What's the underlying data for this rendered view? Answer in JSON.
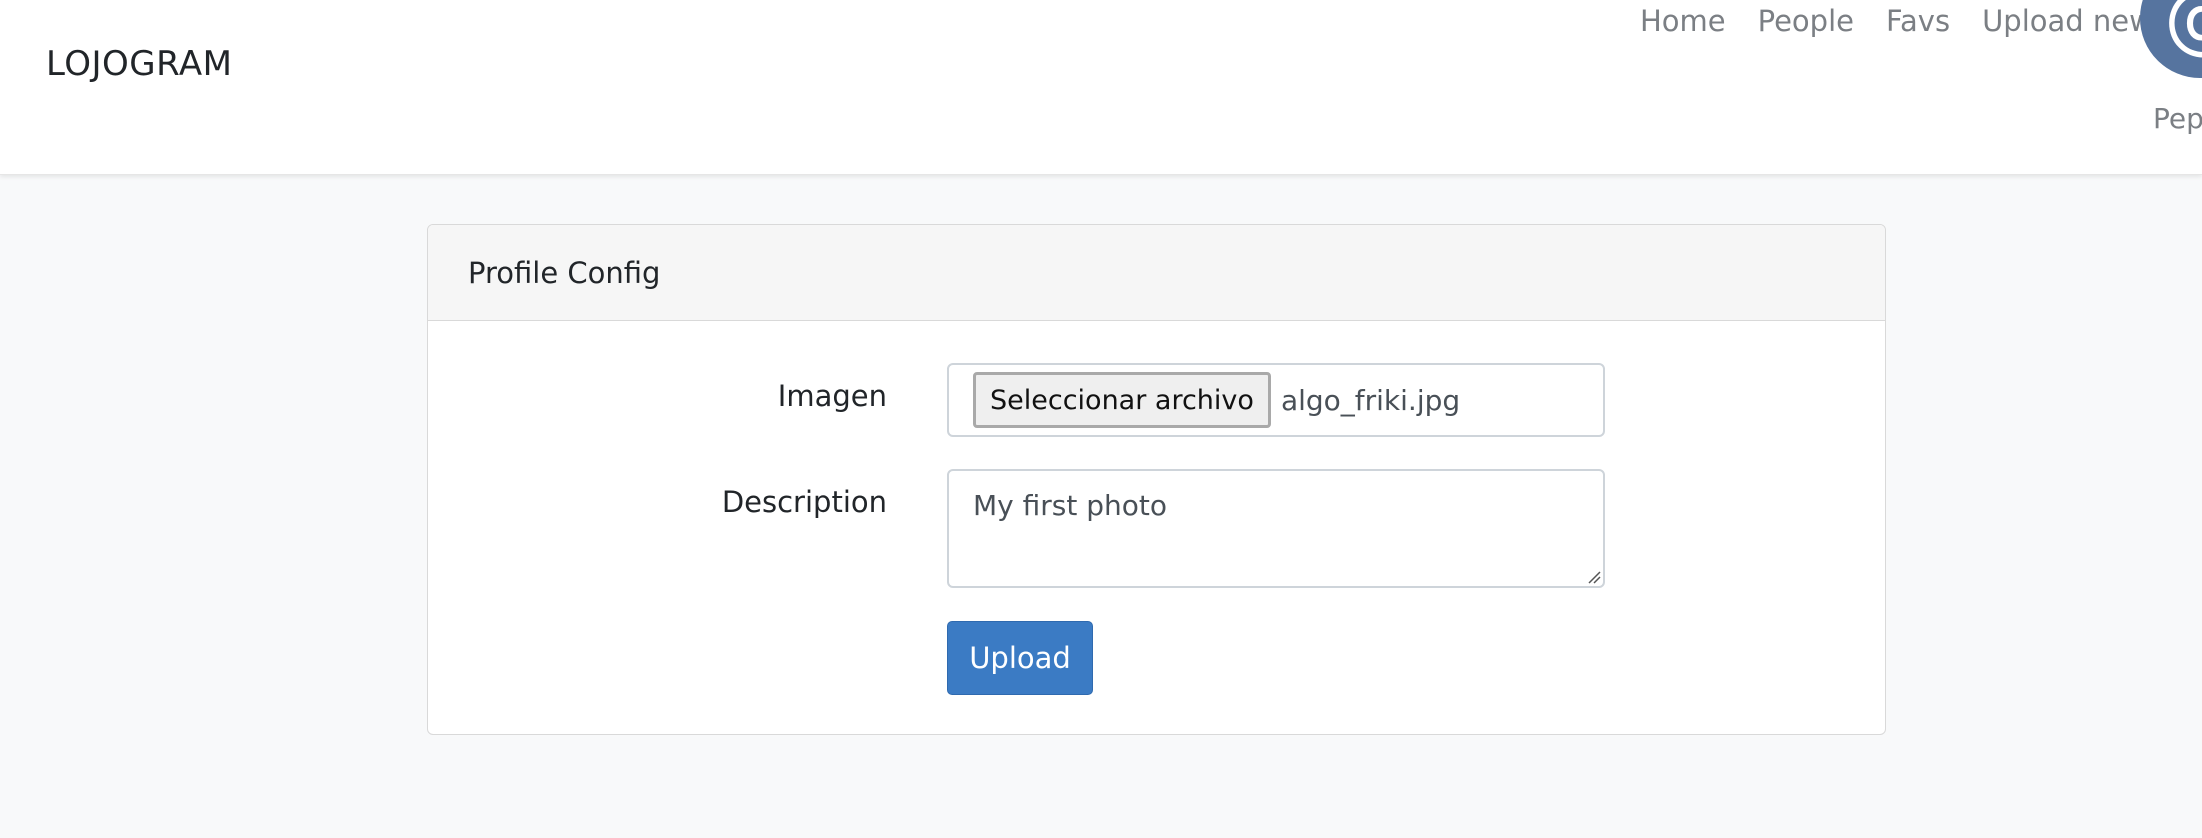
{
  "navbar": {
    "brand": "LOJOGRAM",
    "links": [
      {
        "label": "Home"
      },
      {
        "label": "People"
      },
      {
        "label": "Favs"
      },
      {
        "label": "Upload new"
      }
    ],
    "avatar_text": "@",
    "user_name": "Pep"
  },
  "card": {
    "title": "Profile Config",
    "image_field": {
      "label": "Imagen",
      "button_label": "Seleccionar archivo",
      "file_name": "algo_friki.jpg"
    },
    "description_field": {
      "label": "Description",
      "value": "My first photo"
    },
    "submit_label": "Upload"
  },
  "colors": {
    "primary_button": "#3b7bc4",
    "avatar_bg": "#56749f",
    "page_bg": "#f8f9fa"
  },
  "icons": {
    "resize": "resize-grip-icon"
  }
}
